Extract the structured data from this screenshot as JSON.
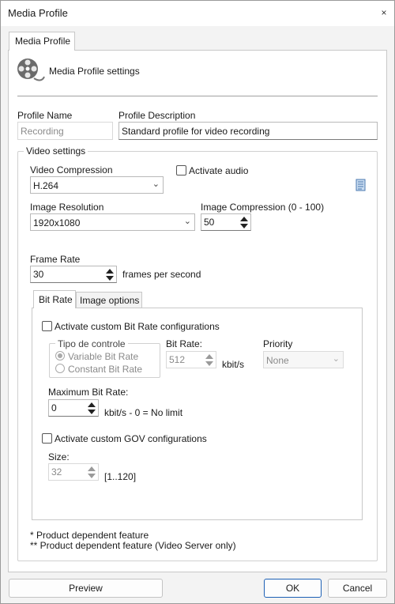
{
  "window": {
    "title": "Media Profile",
    "close_glyph": "×"
  },
  "tab": "Media Profile",
  "header": {
    "icon": "film-reel-icon",
    "text": "Media Profile settings"
  },
  "profile": {
    "name_label": "Profile Name",
    "name_value": "Recording",
    "description_label": "Profile Description",
    "description_value": "Standard profile for video recording"
  },
  "video": {
    "group_title": "Video settings",
    "compression_label": "Video Compression",
    "compression_value": "H.264",
    "activate_audio_label": "Activate audio",
    "resolution_label": "Image Resolution",
    "resolution_value": "1920x1080",
    "image_compression_label": "Image Compression (0 - 100)",
    "image_compression_value": "50",
    "frame_rate_label": "Frame Rate",
    "frame_rate_value": "30",
    "frame_rate_unit": "frames per second",
    "info_icon": "document-icon"
  },
  "inner_tabs": [
    "Bit Rate",
    "Image options"
  ],
  "bitrate": {
    "custom_label": "Activate custom Bit Rate configurations",
    "control_group_title": "Tipo de controle",
    "variable_label": "Variable Bit Rate",
    "constant_label": "Constant Bit Rate",
    "bitrate_label": "Bit Rate:",
    "bitrate_value": "512",
    "bitrate_unit": "kbit/s",
    "priority_label": "Priority",
    "priority_value": "None",
    "max_label": "Maximum Bit Rate:",
    "max_value": "0",
    "max_unit": "kbit/s - 0 = No limit",
    "gov_label": "Activate custom GOV configurations",
    "size_label": "Size:",
    "size_value": "32",
    "size_range": "[1..120]"
  },
  "footnotes": {
    "line1": "* Product dependent feature",
    "line2": "** Product dependent feature (Video Server only)"
  },
  "buttons": {
    "preview": "Preview",
    "ok": "OK",
    "cancel": "Cancel"
  },
  "colors": {
    "accent": "#1b5fb4",
    "window_bg": "#f3f3f3"
  }
}
